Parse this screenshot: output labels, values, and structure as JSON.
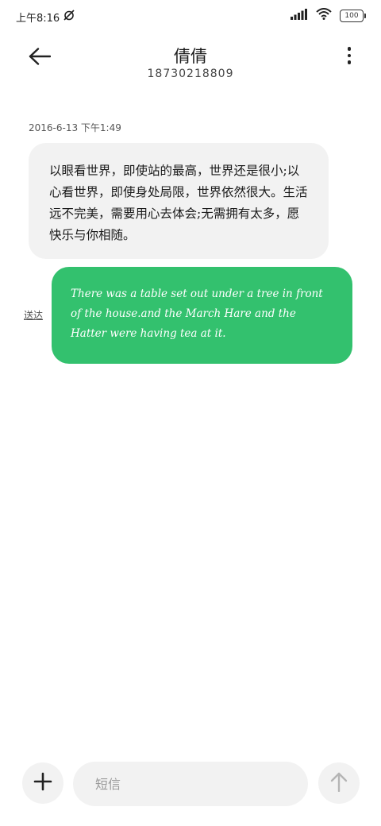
{
  "status_bar": {
    "time": "上午8:16",
    "battery": "100"
  },
  "header": {
    "contact_name": "倩倩",
    "contact_number": "18730218809"
  },
  "conversation": {
    "timestamp": "2016-6-13 下午1:49",
    "incoming_message": "以眼看世界，即使站的最高，世界还是很小;以心看世界，即使身处局限，世界依然很大。生活远不完美，需要用心去体会;无需拥有太多，愿快乐与你相随。",
    "outgoing_message": "There was a table set out under a tree in front of the house.and the March Hare and the Hatter were having tea at it.",
    "outgoing_status": "送达"
  },
  "composer": {
    "placeholder": "短信"
  },
  "colors": {
    "outgoing_bubble": "#33c16e",
    "incoming_bubble": "#f2f2f2"
  }
}
